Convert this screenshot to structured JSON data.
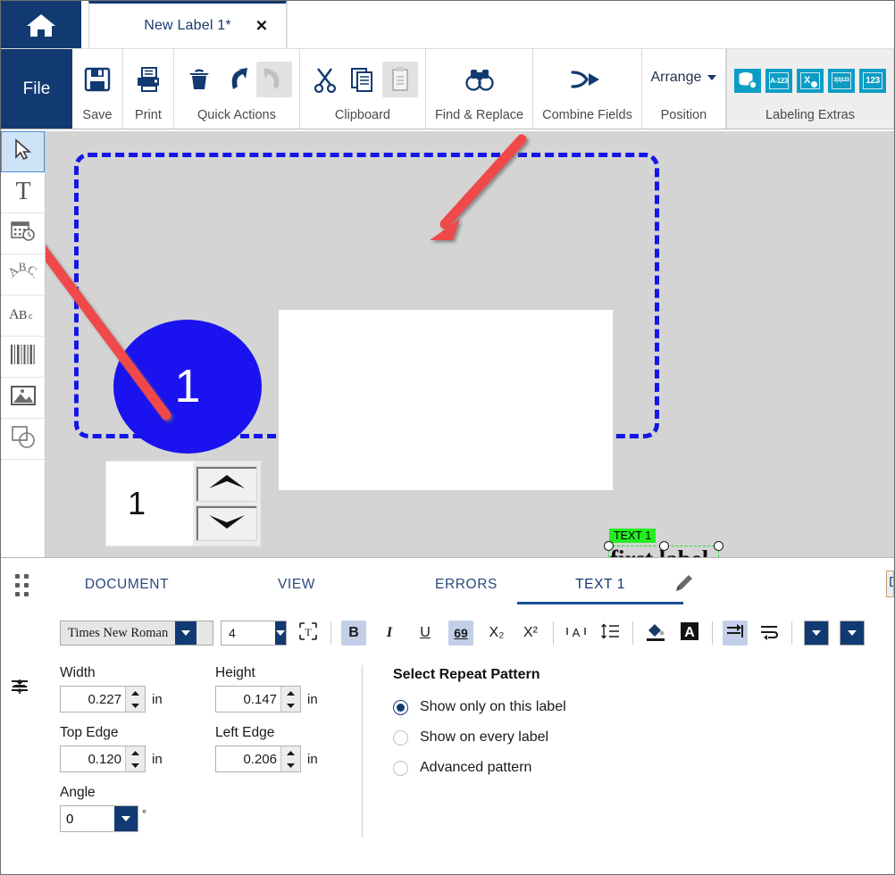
{
  "window": {
    "home_icon": "home-icon",
    "document_tab": {
      "title": "New Label 1*",
      "close": "✕"
    }
  },
  "ribbon": {
    "file_label": "File",
    "groups": [
      {
        "label": "Save",
        "icons": [
          "save-floppy-icon"
        ]
      },
      {
        "label": "Print",
        "icons": [
          "printer-icon"
        ]
      },
      {
        "label": "Quick Actions",
        "icons": [
          "delete-trash-icon",
          "undo-icon",
          "redo-icon"
        ]
      },
      {
        "label": "Clipboard",
        "icons": [
          "cut-scissors-icon",
          "copy-icon",
          "paste-icon"
        ]
      },
      {
        "label": "Find & Replace",
        "icons": [
          "binoculars-icon"
        ]
      },
      {
        "label": "Combine Fields",
        "icons": [
          "merge-arrow-icon"
        ]
      },
      {
        "label": "Position",
        "button": "Arrange",
        "icons": [
          "chevron-down-icon"
        ]
      },
      {
        "label": "Labeling Extras",
        "icons": [
          "database-icon",
          "serial-a123-icon",
          "excel-import-icon",
          "expression-icon",
          "counter-123-icon"
        ]
      }
    ],
    "extras_labels": [
      "",
      "A-123",
      "X",
      "3|1|123",
      "123"
    ]
  },
  "tools": [
    {
      "name": "select-tool",
      "icon": "cursor-arrow-icon",
      "active": true
    },
    {
      "name": "text-tool",
      "icon": "text-t-icon",
      "active": false
    },
    {
      "name": "datetime-tool",
      "icon": "calendar-clock-icon",
      "active": false
    },
    {
      "name": "curved-text-tool",
      "icon": "curved-abc-icon",
      "active": false
    },
    {
      "name": "abc-tool",
      "icon": "abc-icon",
      "active": false
    },
    {
      "name": "barcode-tool",
      "icon": "barcode-icon",
      "active": false
    },
    {
      "name": "image-tool",
      "icon": "picture-icon",
      "active": false
    },
    {
      "name": "shape-tool",
      "icon": "shapes-icon",
      "active": false
    }
  ],
  "canvas": {
    "circle_number": "1",
    "spinner_value": "1",
    "selection": {
      "tag": "TEXT 1",
      "text": "first label"
    }
  },
  "panel": {
    "tabs": [
      {
        "label": "DOCUMENT",
        "active": false
      },
      {
        "label": "VIEW",
        "active": false
      },
      {
        "label": "ERRORS",
        "active": false
      },
      {
        "label": "TEXT 1",
        "active": true
      }
    ],
    "edit_icon": "pencil-icon",
    "partial_tab": "D",
    "drag_handle": "drag-dots-handle"
  },
  "format_toolbar": {
    "font_family": "Times New Roman",
    "font_size": "4",
    "buttons": [
      {
        "name": "autofit-text-button",
        "glyph": "T",
        "active": false
      },
      {
        "name": "bold-button",
        "glyph": "B",
        "active": true
      },
      {
        "name": "italic-button",
        "glyph": "I",
        "active": false
      },
      {
        "name": "underline-button",
        "glyph": "U",
        "active": false
      },
      {
        "name": "strikethrough-69-button",
        "glyph": "69",
        "active": true
      },
      {
        "name": "subscript-button",
        "glyph": "X₂",
        "active": false
      },
      {
        "name": "superscript-button",
        "glyph": "X²",
        "active": false
      },
      {
        "name": "character-spacing-button",
        "glyph": "A",
        "active": false
      },
      {
        "name": "line-spacing-button",
        "glyph": "≡",
        "active": false
      },
      {
        "name": "fill-color-button",
        "glyph": "fill",
        "active": false
      },
      {
        "name": "font-color-button",
        "glyph": "A",
        "active": false
      },
      {
        "name": "indent-button",
        "glyph": "indent",
        "active": true
      },
      {
        "name": "wrap-text-button",
        "glyph": "wrap",
        "active": false
      },
      {
        "name": "text-align-button",
        "glyph": "align",
        "active": false
      },
      {
        "name": "vertical-align-button",
        "glyph": "valign",
        "active": false
      }
    ]
  },
  "properties": {
    "width": {
      "label": "Width",
      "value": "0.227",
      "unit": "in"
    },
    "height": {
      "label": "Height",
      "value": "0.147",
      "unit": "in"
    },
    "top_edge": {
      "label": "Top Edge",
      "value": "0.120",
      "unit": "in"
    },
    "left_edge": {
      "label": "Left Edge",
      "value": "0.206",
      "unit": "in"
    },
    "angle": {
      "label": "Angle",
      "value": "0",
      "unit": "°"
    }
  },
  "repeat_pattern": {
    "title": "Select Repeat Pattern",
    "options": [
      {
        "label": "Show only on this label",
        "selected": true
      },
      {
        "label": "Show on every label",
        "selected": false
      },
      {
        "label": "Advanced pattern",
        "selected": false
      }
    ]
  },
  "colors": {
    "brand_navy": "#123a72",
    "teal": "#0d9dc4",
    "canvas_bg": "#d4d4d4",
    "label_border_blue": "#1515e8",
    "selection_green": "#22ee22",
    "annotation_red": "#ef4444",
    "circle_blue": "#1a12ef"
  }
}
